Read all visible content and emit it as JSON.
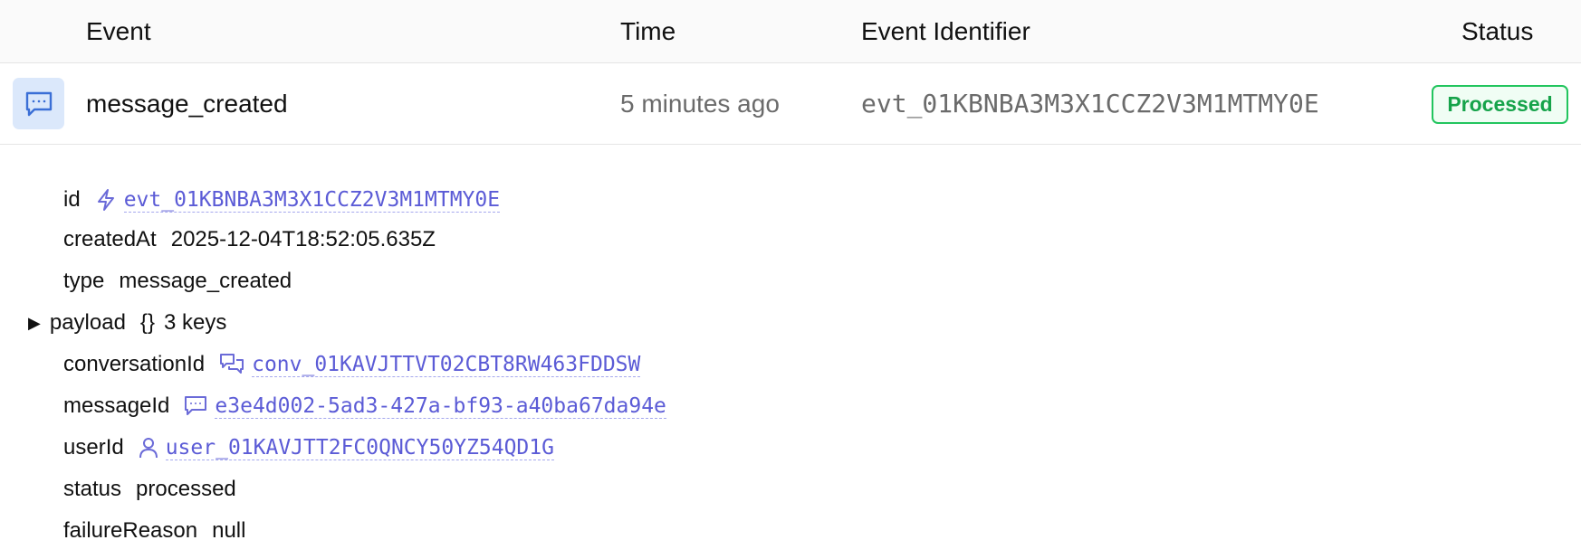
{
  "header": {
    "col_event": "Event",
    "col_time": "Time",
    "col_identifier": "Event Identifier",
    "col_status": "Status"
  },
  "row": {
    "icon": "message-icon",
    "event": "message_created",
    "time": "5 minutes ago",
    "identifier": "evt_01KBNBA3M3X1CCZ2V3M1MTMY0E",
    "status": "Processed"
  },
  "detail": {
    "id": {
      "key": "id",
      "icon": "bolt-icon",
      "value": "evt_01KBNBA3M3X1CCZ2V3M1MTMY0E"
    },
    "createdAt": {
      "key": "createdAt",
      "value": "2025-12-04T18:52:05.635Z"
    },
    "type": {
      "key": "type",
      "value": "message_created"
    },
    "payload": {
      "toggle": "▶",
      "key": "payload",
      "braces": "{}",
      "summary": "3 keys"
    },
    "conversationId": {
      "key": "conversationId",
      "icon": "conversation-icon",
      "value": "conv_01KAVJTTVT02CBT8RW463FDDSW"
    },
    "messageId": {
      "key": "messageId",
      "icon": "message-icon",
      "value": "e3e4d002-5ad3-427a-bf93-a40ba67da94e"
    },
    "userId": {
      "key": "userId",
      "icon": "user-icon",
      "value": "user_01KAVJTT2FC0QNCY50YZ54QD1G"
    },
    "status": {
      "key": "status",
      "value": "processed"
    },
    "failureReason": {
      "key": "failureReason",
      "value": "null"
    }
  },
  "colors": {
    "accent_link": "#5b5bd6",
    "status_green": "#16a34a",
    "icon_bg": "#dbe8fb"
  }
}
